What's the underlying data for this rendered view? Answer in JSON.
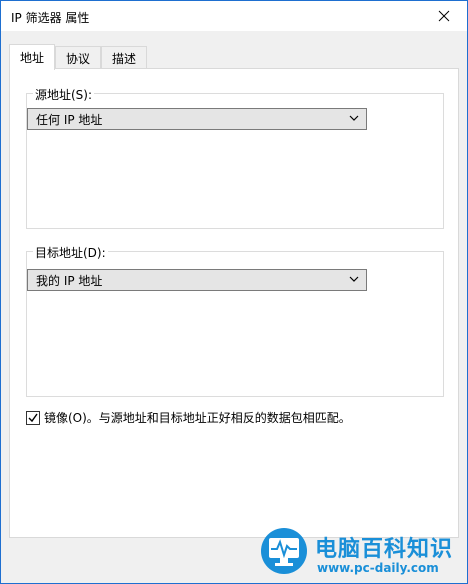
{
  "window": {
    "title": "IP 筛选器 属性"
  },
  "tabs": [
    {
      "label": "地址"
    },
    {
      "label": "协议"
    },
    {
      "label": "描述"
    }
  ],
  "source": {
    "group_label": "源地址(S):",
    "selected": "任何 IP 地址"
  },
  "destination": {
    "group_label": "目标地址(D):",
    "selected": "我的 IP 地址"
  },
  "mirror": {
    "checked": true,
    "label": "镜像(O)。与源地址和目标地址正好相反的数据包相匹配。"
  },
  "watermark": {
    "brand_cn": "电脑百科知识",
    "brand_url": "www.pc-daily.com"
  },
  "colors": {
    "title_border": "#1e6fd0",
    "watermark": "#1a8fd8"
  }
}
